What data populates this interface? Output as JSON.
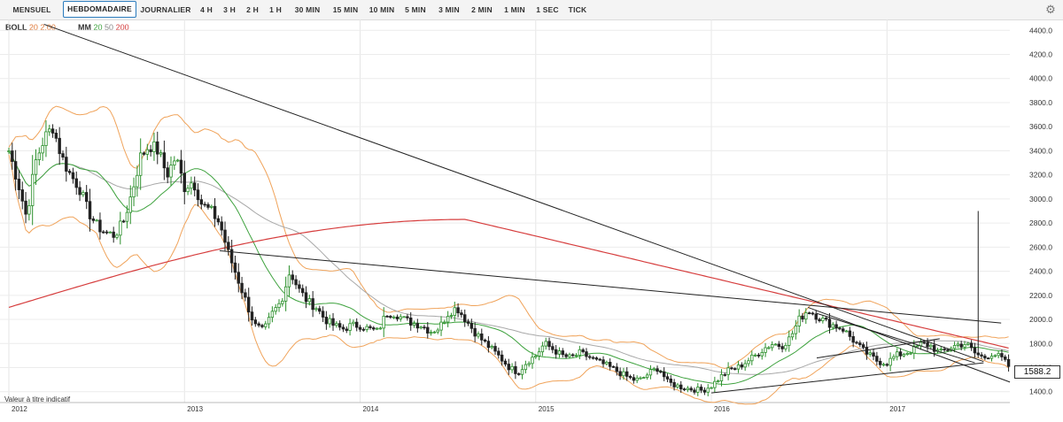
{
  "toolbar": {
    "tabs": [
      "MENSUEL",
      "HEBDOMADAIRE",
      "JOURNALIER",
      "4 H",
      "3 H",
      "2 H",
      "1 H",
      "30 MIN",
      "15 MIN",
      "10 MIN",
      "5 MIN",
      "3 MIN",
      "2 MIN",
      "1 MIN",
      "1 SEC",
      "TICK"
    ],
    "active": "HEBDOMADAIRE",
    "settings_icon": "gear-icon"
  },
  "legend": {
    "boll_label": "BOLL",
    "boll_params": "20 2.00",
    "mm_label": "MM",
    "mm_20": "20",
    "mm_50": "50",
    "mm_200": "200"
  },
  "colors": {
    "boll": "#f0a35a",
    "mm20": "#3ea23e",
    "mm50": "#a8a8a8",
    "mm200": "#d63d3d",
    "candle_up": "#2a8f2a",
    "candle_down": "#222222",
    "trendline": "#222222"
  },
  "footer_note": "Valeur à titre indicatif",
  "last_price": "1588.2",
  "chart_data": {
    "type": "candlestick",
    "x_tick_labels": [
      "2012",
      "2013",
      "2014",
      "2015",
      "2016",
      "2017"
    ],
    "xlim": [
      2012.0,
      2017.75
    ],
    "y_tick_labels": [
      "4400.0",
      "4200.0",
      "4000.0",
      "3800.0",
      "3600.0",
      "3400.0",
      "3200.0",
      "3000.0",
      "2800.0",
      "2600.0",
      "2400.0",
      "2200.0",
      "2000.0",
      "1800.0",
      "1600.0",
      "1400.0"
    ],
    "ylim": [
      1310,
      4490
    ],
    "close_path": [
      [
        2012.0,
        3400
      ],
      [
        2012.05,
        3150
      ],
      [
        2012.1,
        2850
      ],
      [
        2012.15,
        3300
      ],
      [
        2012.2,
        3500
      ],
      [
        2012.25,
        3600
      ],
      [
        2012.3,
        3350
      ],
      [
        2012.35,
        3200
      ],
      [
        2012.4,
        3100
      ],
      [
        2012.45,
        2900
      ],
      [
        2012.5,
        2780
      ],
      [
        2012.55,
        2720
      ],
      [
        2012.6,
        2700
      ],
      [
        2012.65,
        2800
      ],
      [
        2012.7,
        3050
      ],
      [
        2012.75,
        3350
      ],
      [
        2012.8,
        3450
      ],
      [
        2012.85,
        3400
      ],
      [
        2012.9,
        3200
      ],
      [
        2012.95,
        3350
      ],
      [
        2013.0,
        3100
      ],
      [
        2013.05,
        3150
      ],
      [
        2013.1,
        2950
      ],
      [
        2013.15,
        2900
      ],
      [
        2013.2,
        2800
      ],
      [
        2013.25,
        2550
      ],
      [
        2013.3,
        2350
      ],
      [
        2013.35,
        2150
      ],
      [
        2013.4,
        1950
      ],
      [
        2013.45,
        1900
      ],
      [
        2013.5,
        2050
      ],
      [
        2013.55,
        2150
      ],
      [
        2013.6,
        2400
      ],
      [
        2013.65,
        2250
      ],
      [
        2013.7,
        2150
      ],
      [
        2013.75,
        2100
      ],
      [
        2013.8,
        2000
      ],
      [
        2013.85,
        1950
      ],
      [
        2013.9,
        1920
      ],
      [
        2013.95,
        1950
      ],
      [
        2014.0,
        1950
      ],
      [
        2014.05,
        1920
      ],
      [
        2014.1,
        1900
      ],
      [
        2014.15,
        2050
      ],
      [
        2014.2,
        2050
      ],
      [
        2014.25,
        2000
      ],
      [
        2014.3,
        1970
      ],
      [
        2014.35,
        1950
      ],
      [
        2014.4,
        1900
      ],
      [
        2014.45,
        1930
      ],
      [
        2014.5,
        2050
      ],
      [
        2014.55,
        2100
      ],
      [
        2014.6,
        2000
      ],
      [
        2014.65,
        1900
      ],
      [
        2014.7,
        1820
      ],
      [
        2014.75,
        1750
      ],
      [
        2014.8,
        1680
      ],
      [
        2014.85,
        1600
      ],
      [
        2014.9,
        1560
      ],
      [
        2014.95,
        1650
      ],
      [
        2015.0,
        1700
      ],
      [
        2015.05,
        1800
      ],
      [
        2015.1,
        1750
      ],
      [
        2015.15,
        1700
      ],
      [
        2015.2,
        1680
      ],
      [
        2015.25,
        1720
      ],
      [
        2015.3,
        1690
      ],
      [
        2015.35,
        1650
      ],
      [
        2015.4,
        1620
      ],
      [
        2015.45,
        1580
      ],
      [
        2015.5,
        1540
      ],
      [
        2015.55,
        1500
      ],
      [
        2015.6,
        1500
      ],
      [
        2015.65,
        1560
      ],
      [
        2015.7,
        1600
      ],
      [
        2015.75,
        1480
      ],
      [
        2015.8,
        1450
      ],
      [
        2015.85,
        1430
      ],
      [
        2015.9,
        1420
      ],
      [
        2015.95,
        1410
      ],
      [
        2016.0,
        1450
      ],
      [
        2016.05,
        1520
      ],
      [
        2016.1,
        1580
      ],
      [
        2016.15,
        1600
      ],
      [
        2016.2,
        1650
      ],
      [
        2016.25,
        1700
      ],
      [
        2016.3,
        1760
      ],
      [
        2016.35,
        1800
      ],
      [
        2016.4,
        1780
      ],
      [
        2016.45,
        1850
      ],
      [
        2016.5,
        2000
      ],
      [
        2016.55,
        2080
      ],
      [
        2016.6,
        2030
      ],
      [
        2016.65,
        1980
      ],
      [
        2016.7,
        1950
      ],
      [
        2016.75,
        1920
      ],
      [
        2016.8,
        1840
      ],
      [
        2016.85,
        1760
      ],
      [
        2016.9,
        1700
      ],
      [
        2016.95,
        1650
      ],
      [
        2017.0,
        1640
      ],
      [
        2017.05,
        1700
      ],
      [
        2017.1,
        1720
      ],
      [
        2017.15,
        1750
      ],
      [
        2017.2,
        1800
      ],
      [
        2017.25,
        1780
      ],
      [
        2017.3,
        1720
      ],
      [
        2017.35,
        1760
      ],
      [
        2017.4,
        1790
      ],
      [
        2017.45,
        1800
      ],
      [
        2017.5,
        1720
      ],
      [
        2017.55,
        1680
      ],
      [
        2017.6,
        1720
      ],
      [
        2017.65,
        1680
      ],
      [
        2017.7,
        1600
      ]
    ]
  }
}
